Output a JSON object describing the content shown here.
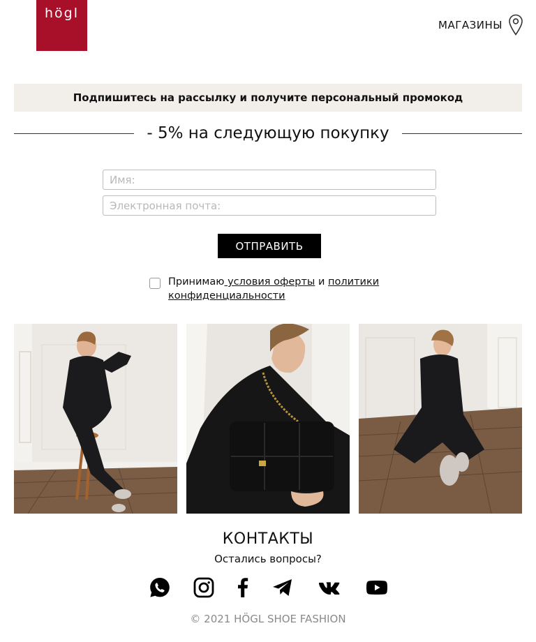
{
  "brand": {
    "logo_text": "högl",
    "brand_color": "#a8102a"
  },
  "header": {
    "stores_label": "МАГАЗИНЫ",
    "stores_icon": "map-pin-icon"
  },
  "promo": {
    "banner_text": "Подпишитесь на рассылку и получите персональный промокод",
    "discount_text": "- 5% на следующую покупку"
  },
  "form": {
    "name_placeholder": "Имя:",
    "email_placeholder": "Электронная почта:",
    "name_value": "",
    "email_value": "",
    "submit_label": "ОТПРАВИТЬ"
  },
  "consent": {
    "prefix": "Принимаю",
    "offer_link": " условия оферты",
    "joiner": " и ",
    "privacy_link_1": "политики",
    "privacy_link_2": "конфиденциальности",
    "checked": false
  },
  "gallery": {
    "photos": [
      {
        "name": "woman-in-black-suit-on-stool"
      },
      {
        "name": "woman-with-black-quilted-bag"
      },
      {
        "name": "woman-in-black-suit-sitting-on-floor"
      }
    ]
  },
  "contacts": {
    "title": "КОНТАКТЫ",
    "subtitle": "Остались вопросы?",
    "socials": [
      "whatsapp-icon",
      "instagram-icon",
      "facebook-icon",
      "telegram-icon",
      "vk-icon",
      "youtube-icon"
    ]
  },
  "footer": {
    "copyright": "© 2021 HÖGL SHOE FASHION"
  },
  "colors": {
    "promo_bg": "#f2efea",
    "button_bg": "#000000",
    "copyright": "#8a8a8a"
  }
}
